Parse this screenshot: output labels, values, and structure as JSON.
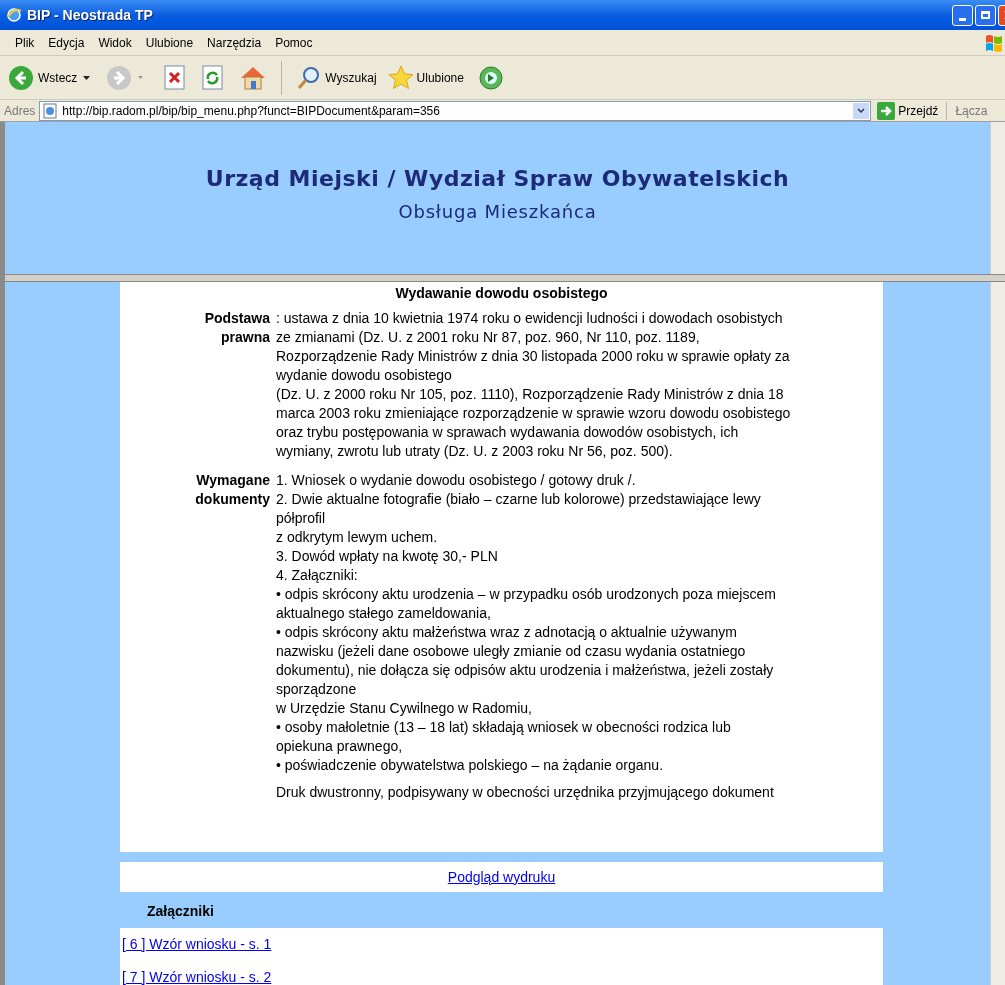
{
  "window": {
    "title": "BIP - Neostrada TP"
  },
  "menu": [
    "Plik",
    "Edycja",
    "Widok",
    "Ulubione",
    "Narzędzia",
    "Pomoc"
  ],
  "toolbar": {
    "back": "Wstecz",
    "search": "Wyszukaj",
    "favorites": "Ulubione"
  },
  "address": {
    "label": "Adres",
    "url": "http://bip.radom.pl/bip/bip_menu.php?funct=BIPDocument&param=356",
    "go": "Przejdź",
    "links": "Łącza"
  },
  "header": {
    "title": "Urząd Miejski / Wydział Spraw Obywatelskich",
    "subtitle": "Obsługa Mieszkańca"
  },
  "document": {
    "title": "Wydawanie dowodu osobistego",
    "sections": [
      {
        "label": "Podstawa prawna",
        "paragraphs": [
          [
            ": ustawa z dnia 10 kwietnia 1974 roku o ewidencji ludności i dowodach osobistych",
            "ze zmianami (Dz. U. z 2001 roku Nr 87, poz. 960, Nr 110, poz. 1189,",
            "Rozporządzenie Rady Ministrów z dnia 30 listopada 2000 roku w sprawie opłaty za",
            "wydanie dowodu osobistego",
            "(Dz. U. z 2000 roku Nr 105, poz. 1110), Rozporządzenie Rady Ministrów z dnia 18",
            "marca 2003 roku zmieniające rozporządzenie w sprawie wzoru dowodu osobistego",
            "oraz trybu postępowania w sprawach wydawania dowodów osobistych, ich",
            "wymiany, zwrotu lub utraty (Dz. U. z 2003 roku Nr 56, poz. 500)."
          ]
        ]
      },
      {
        "label": "Wymagane dokumenty",
        "paragraphs": [
          [
            "1. Wniosek o wydanie dowodu osobistego / gotowy druk /.",
            "2. Dwie aktualne fotografie (biało – czarne lub kolorowe) przedstawiające lewy",
            "półprofil",
            "z odkrytym lewym uchem.",
            "3. Dowód wpłaty na kwotę 30,- PLN",
            "4. Załączniki:",
            "• odpis skrócony aktu urodzenia – w przypadku osób urodzonych poza miejscem",
            "aktualnego stałego zameldowania,",
            "• odpis skrócony aktu małżeństwa wraz z adnotacją o aktualnie używanym",
            "nazwisku (jeżeli dane osobowe uległy zmianie od czasu wydania ostatniego",
            "dokumentu), nie dołącza się odpisów aktu urodzenia i małżeństwa, jeżeli zostały",
            "sporządzone",
            "w Urzędzie Stanu Cywilnego w Radomiu,",
            "• osoby małoletnie (13 – 18 lat) składają wniosek w obecności rodzica lub",
            "opiekuna prawnego,",
            "• poświadczenie obywatelstwa polskiego – na żądanie organu."
          ],
          [
            "Druk dwustronny, podpisywany w obecności urzędnika przyjmującego dokument"
          ]
        ]
      }
    ]
  },
  "print_link": "Podgląd wydruku",
  "attachments": {
    "heading": "Załączniki",
    "items": [
      "[ 6 ] Wzór wniosku - s. 1",
      "[ 7 ] Wzór wniosku - s. 2"
    ]
  }
}
